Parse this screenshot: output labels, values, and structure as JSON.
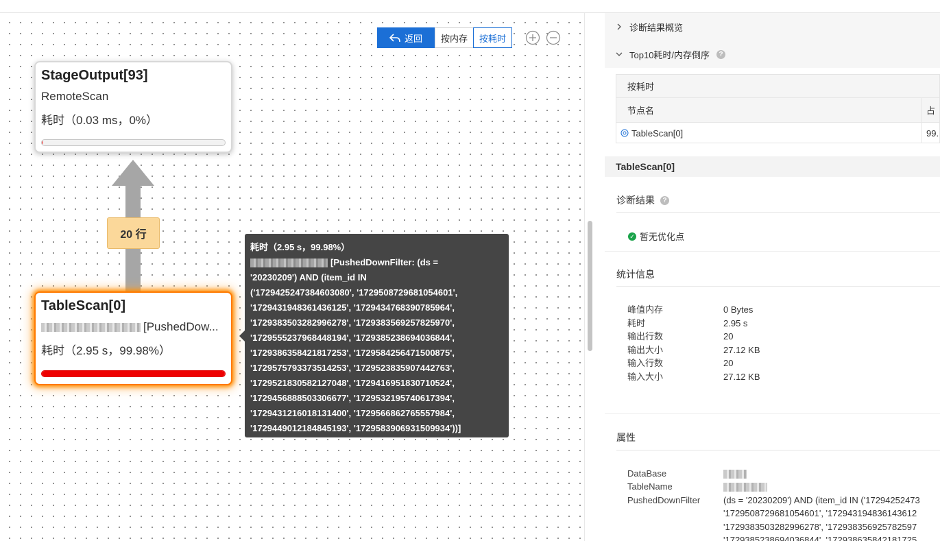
{
  "toolbar": {
    "back_label": "返回",
    "by_memory_label": "按内存",
    "by_time_label": "按耗时"
  },
  "nodes": {
    "stage": {
      "title": "StageOutput[93]",
      "subtitle": "RemoteScan",
      "cost": "耗时（0.03 ms，0%）",
      "progress_fraction": 0.0003
    },
    "scan": {
      "title": "TableScan[0]",
      "subtitle": "[PushedDow...",
      "cost": "耗时（2.95 s，99.98%）",
      "progress_fraction": 0.9998
    },
    "edge_label": "20 行"
  },
  "tooltip": {
    "lines": [
      "耗时（2.95 s，99.98%）",
      "[PushedDownFilter: (ds =",
      "'20230209') AND (item_id IN",
      "('1729425247384603080', '1729508729681054601',",
      "'1729431948361436125', '1729434768390785964',",
      "'1729383503282996278', '1729383569257825970',",
      "'1729555237968448194', '1729385238694036844',",
      "'1729386358421817253', '1729584256471500875',",
      "'1729575793373514253', '1729523835907442763',",
      "'1729521830582127048', '1729416951830710524',",
      "'1729456888503306677', '1729532195740617394',",
      "'1729431216018131400', '1729566862765557984',",
      "'1729449012184845193', '1729583906931509934'))]"
    ]
  },
  "panel": {
    "acc_overview": "诊断结果概览",
    "acc_top10": "Top10耗时/内存倒序",
    "top_table": {
      "caption": "按耗时",
      "col_node": "节点名",
      "col_pct": "占",
      "rows": [
        {
          "node": "TableScan[0]",
          "pct": "99."
        }
      ]
    },
    "section_title": "TableScan[0]",
    "diag_title": "诊断结果",
    "diag_ok": "暂无优化点",
    "stats_title": "统计信息",
    "stats": [
      {
        "k": "峰值内存",
        "v": "0 Bytes"
      },
      {
        "k": "耗时",
        "v": "2.95 s"
      },
      {
        "k": "输出行数",
        "v": "20"
      },
      {
        "k": "输出大小",
        "v": "27.12 KB"
      },
      {
        "k": "输入行数",
        "v": "20"
      },
      {
        "k": "输入大小",
        "v": "27.12 KB"
      }
    ],
    "props_title": "属性",
    "props": [
      {
        "k": "DataBase",
        "v": ""
      },
      {
        "k": "TableName",
        "v": ""
      },
      {
        "k": "PushedDownFilter",
        "v": "(ds = '20230209') AND (item_id IN ('17294252473"
      }
    ],
    "pdf_more": [
      "'1729508729681054601', '172943194836143612",
      "'1729383503282996278', '172938356925782597",
      "'1729385238694036844', '172938635842181725"
    ]
  },
  "colors": {
    "primary": "#1b6fd6",
    "hot": "#ff7a00",
    "bar_red": "#ee0000",
    "badge": "#fbd89a",
    "tooltip_bg": "#454545",
    "ok_green": "#1aa34a"
  }
}
